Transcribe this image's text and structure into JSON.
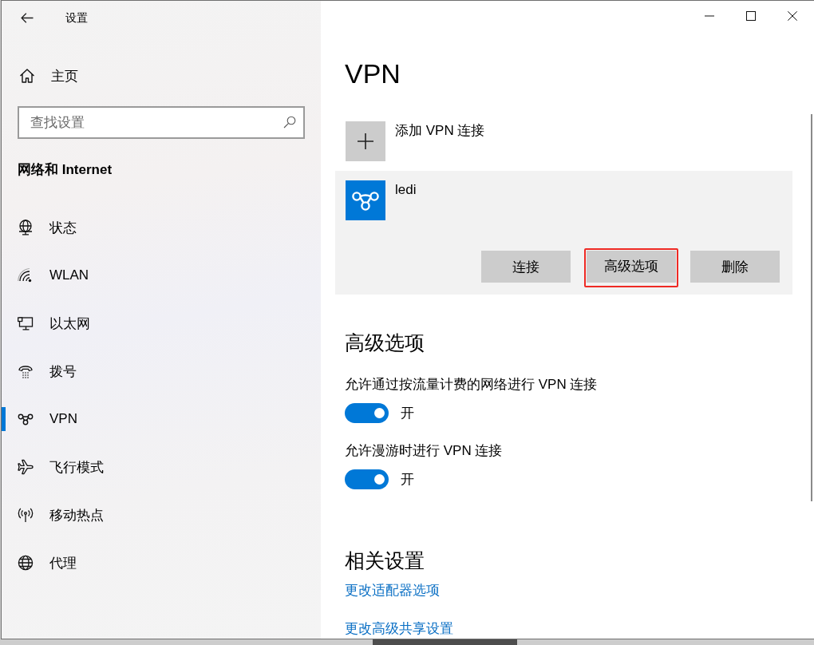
{
  "window": {
    "title": "设置"
  },
  "sidebar": {
    "home": "主页",
    "search": {
      "placeholder": "查找设置"
    },
    "section_title": "网络和 Internet",
    "items": [
      {
        "label": "状态",
        "kind": "status",
        "selected": false
      },
      {
        "label": "WLAN",
        "kind": "wifi",
        "selected": false
      },
      {
        "label": "以太网",
        "kind": "ethernet",
        "selected": false
      },
      {
        "label": "拨号",
        "kind": "dialup",
        "selected": false
      },
      {
        "label": "VPN",
        "kind": "vpn",
        "selected": true
      },
      {
        "label": "飞行模式",
        "kind": "airplane",
        "selected": false
      },
      {
        "label": "移动热点",
        "kind": "hotspot",
        "selected": false
      },
      {
        "label": "代理",
        "kind": "proxy",
        "selected": false
      }
    ]
  },
  "page": {
    "title": "VPN",
    "add_connection": "添加 VPN 连接",
    "connections": [
      {
        "name": "ledi",
        "selected": true,
        "buttons": [
          {
            "label": "连接",
            "highlighted": false
          },
          {
            "label": "高级选项",
            "highlighted": true
          },
          {
            "label": "删除",
            "highlighted": false
          }
        ]
      }
    ],
    "advanced": {
      "title": "高级选项",
      "options": [
        {
          "label": "允许通过按流量计费的网络进行 VPN 连接",
          "on": true,
          "state_label": "开"
        },
        {
          "label": "允许漫游时进行 VPN 连接",
          "on": true,
          "state_label": "开"
        }
      ]
    },
    "related": {
      "title": "相关设置",
      "links": [
        "更改适配器选项",
        "更改高级共享设置"
      ]
    }
  }
}
